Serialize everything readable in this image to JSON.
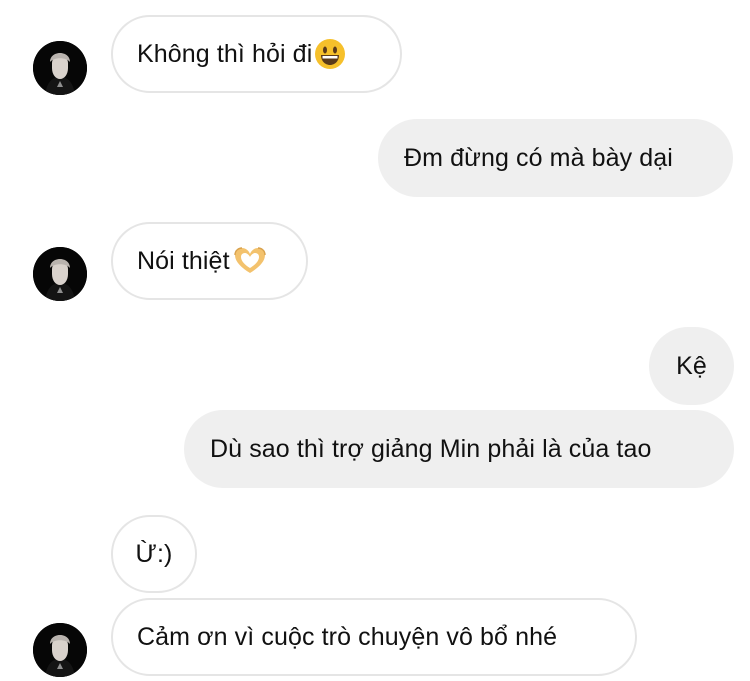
{
  "messages": [
    {
      "side": "in",
      "text": "Không thì hỏi đi",
      "emoji": "grinning-face-emoji",
      "avatar": true
    },
    {
      "side": "out",
      "text": "Đm đừng có mà bày dại"
    },
    {
      "side": "in",
      "text": "Nói thiệt",
      "emoji": "heart-hands-emoji",
      "avatar": true
    },
    {
      "side": "out",
      "text": "Kệ"
    },
    {
      "side": "out",
      "text": "Dù sao thì trợ giảng Min phải là của tao"
    },
    {
      "side": "in",
      "text": "Ừ:)",
      "avatar": false
    },
    {
      "side": "in",
      "text": "Cảm ơn vì cuộc trò chuyện vô bổ nhé",
      "avatar": true
    }
  ],
  "colors": {
    "incoming_bubble_bg": "#ffffff",
    "incoming_bubble_border": "#e5e5e5",
    "outgoing_bubble_bg": "#efefef",
    "text": "#111111",
    "emoji_face": "#f6c02b",
    "emoji_heart_hands": "#f3c26d"
  }
}
